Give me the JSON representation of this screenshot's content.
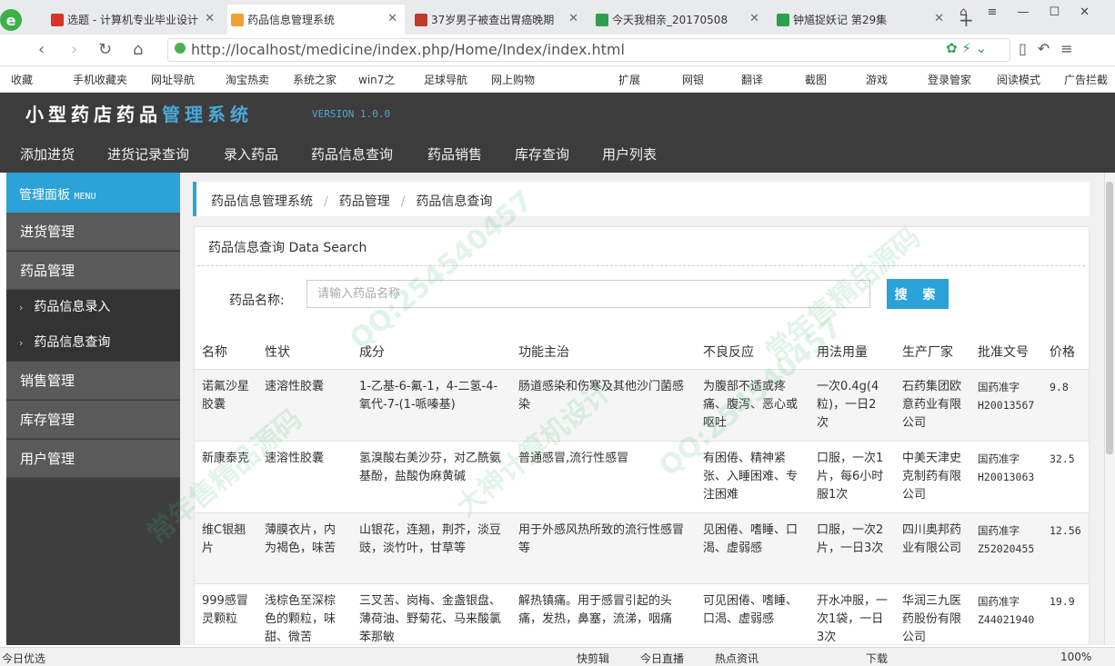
{
  "browser": {
    "tabs": [
      {
        "title": "选题 - 计算机专业毕业设计",
        "color": "#d9342b",
        "active": false
      },
      {
        "title": "药品信息管理系统",
        "color": "#f0a030",
        "active": true
      },
      {
        "title": "37岁男子被查出胃癌晚期",
        "color": "#c0392b",
        "active": false
      },
      {
        "title": "今天我相亲_20170508",
        "color": "#2e9e4f",
        "active": false
      },
      {
        "title": "钟馗捉妖记 第29集",
        "color": "#2e9e4f",
        "active": false
      }
    ],
    "new_tab": "+",
    "url": "http://localhost/medicine/index.php/Home/Index/index.html",
    "bookmarks_left": [
      "收藏",
      "手机收藏夹",
      "网址导航",
      "淘宝热卖",
      "系统之家",
      "win7之",
      "足球导航",
      "网上购物"
    ],
    "bookmarks_right": [
      "扩展",
      "网银",
      "翻译",
      "截图",
      "游戏",
      "登录管家",
      "阅读模式",
      "广告拦截"
    ]
  },
  "app": {
    "title_main": "小型药店药品",
    "title_accent": "管理系统",
    "version": "VERSION 1.0.0",
    "nav": [
      "添加进货",
      "进货记录查询",
      "录入药品",
      "药品信息查询",
      "药品销售",
      "库存查询",
      "用户列表"
    ]
  },
  "sidebar": {
    "header": "管理面板",
    "header_small": "MENU",
    "items": [
      {
        "label": "进货管理"
      },
      {
        "label": "药品管理"
      },
      {
        "label": "药品信息录入"
      },
      {
        "label": "药品信息查询"
      },
      {
        "label": "销售管理"
      },
      {
        "label": "库存管理"
      },
      {
        "label": "用户管理"
      }
    ]
  },
  "breadcrumb": [
    "药品信息管理系统",
    "药品管理",
    "药品信息查询"
  ],
  "panel": {
    "title": "药品信息查询 Data Search",
    "search_label": "药品名称:",
    "search_placeholder": "请输入药品名称",
    "search_button": "搜 索"
  },
  "table": {
    "headers": [
      "名称",
      "性状",
      "成分",
      "功能主治",
      "不良反应",
      "用法用量",
      "生产厂家",
      "批准文号",
      "价格"
    ],
    "rows": [
      [
        "诺氟沙星胶囊",
        "速溶性胶囊",
        "1-乙基-6-氟-1，4-二氢-4-氧代-7-(1-哌嗪基)",
        "肠道感染和伤寒及其他沙门菌感染",
        "为腹部不适或疼痛、腹泻、恶心或呕吐",
        "一次0.4g(4粒)，一日2次",
        "石药集团欧意药业有限公司",
        "国药准字H20013567",
        "9.8"
      ],
      [
        "新康泰克",
        "速溶性胶囊",
        "氢溴酸右美沙芬，对乙酰氨基酚，盐酸伪麻黄碱",
        "普通感冒,流行性感冒",
        "有困倦、精神紧张、入睡困难、专注困难",
        "口服，一次1片，每6小时服1次",
        "中美天津史克制药有限公司",
        "国药准字H20013063",
        "32.5"
      ],
      [
        "维C银翘片",
        "薄膜衣片，内为褐色，味苦",
        "山银花，连翘，荆芥，淡豆豉，淡竹叶，甘草等",
        "用于外感风热所致的流行性感冒等",
        "见困倦、嗜睡、口渴、虚弱感",
        "口服，一次2片，一日3次",
        "四川奥邦药业有限公司",
        "国药准字Z52020455",
        "12.56"
      ],
      [
        "999感冒灵颗粒",
        "浅棕色至深棕色的颗粒，味甜、微苦",
        "三叉苦、岗梅、金盏银盘、薄荷油、野菊花、马来酸氯苯那敏",
        "解热镇痛。用于感冒引起的头痛，发热，鼻塞，流涕，咽痛",
        "可见困倦、嗜睡、口渴、虚弱感",
        "开水冲服，一次1袋，一日3次",
        "华润三九医药股份有限公司",
        "国药准字Z44021940",
        "19.9"
      ]
    ]
  },
  "statusbar": {
    "left": "今日优选",
    "items": [
      "快剪辑",
      "今日直播",
      "热点资讯",
      "下载",
      "100%"
    ]
  },
  "watermark": [
    "QQ:254540457",
    "大神计算机设计",
    "常年售精品源码"
  ]
}
